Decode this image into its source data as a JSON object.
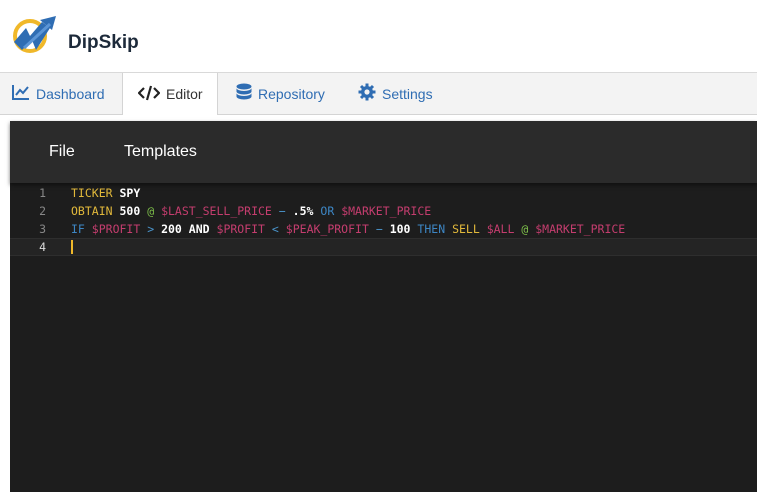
{
  "app": {
    "logo_text": "DipSkip"
  },
  "tabs": [
    {
      "label": "Dashboard",
      "icon": "chart-line-icon",
      "active": false
    },
    {
      "label": "Editor",
      "icon": "code-icon",
      "active": true
    },
    {
      "label": "Repository",
      "icon": "database-icon",
      "active": false
    },
    {
      "label": "Settings",
      "icon": "gear-icon",
      "active": false
    }
  ],
  "editor": {
    "menu": {
      "file": "File",
      "templates": "Templates"
    },
    "line_numbers": [
      "1",
      "2",
      "3",
      "4"
    ],
    "lines": [
      [
        {
          "t": "TICKER",
          "c": "kw"
        },
        {
          "t": " ",
          "c": "sym"
        },
        {
          "t": "SPY",
          "c": "white"
        }
      ],
      [
        {
          "t": "OBTAIN",
          "c": "kw"
        },
        {
          "t": " ",
          "c": "sym"
        },
        {
          "t": "500",
          "c": "num"
        },
        {
          "t": " ",
          "c": "sym"
        },
        {
          "t": "@",
          "c": "at"
        },
        {
          "t": " ",
          "c": "sym"
        },
        {
          "t": "$LAST_SELL_PRICE",
          "c": "var"
        },
        {
          "t": " ",
          "c": "sym"
        },
        {
          "t": "−",
          "c": "op"
        },
        {
          "t": " ",
          "c": "sym"
        },
        {
          "t": ".5%",
          "c": "pct"
        },
        {
          "t": " ",
          "c": "sym"
        },
        {
          "t": "OR",
          "c": "blue"
        },
        {
          "t": " ",
          "c": "sym"
        },
        {
          "t": "$MARKET_PRICE",
          "c": "var"
        }
      ],
      [
        {
          "t": "IF",
          "c": "blue"
        },
        {
          "t": " ",
          "c": "sym"
        },
        {
          "t": "$PROFIT",
          "c": "var"
        },
        {
          "t": " ",
          "c": "sym"
        },
        {
          "t": ">",
          "c": "op"
        },
        {
          "t": " ",
          "c": "sym"
        },
        {
          "t": "200",
          "c": "num"
        },
        {
          "t": " ",
          "c": "sym"
        },
        {
          "t": "AND",
          "c": "white"
        },
        {
          "t": " ",
          "c": "sym"
        },
        {
          "t": "$PROFIT",
          "c": "var"
        },
        {
          "t": " ",
          "c": "sym"
        },
        {
          "t": "<",
          "c": "op"
        },
        {
          "t": " ",
          "c": "sym"
        },
        {
          "t": "$PEAK_PROFIT",
          "c": "var"
        },
        {
          "t": " ",
          "c": "sym"
        },
        {
          "t": "−",
          "c": "op"
        },
        {
          "t": " ",
          "c": "sym"
        },
        {
          "t": "100",
          "c": "num"
        },
        {
          "t": " ",
          "c": "sym"
        },
        {
          "t": "THEN",
          "c": "blue"
        },
        {
          "t": " ",
          "c": "sym"
        },
        {
          "t": "SELL",
          "c": "kw"
        },
        {
          "t": " ",
          "c": "sym"
        },
        {
          "t": "$ALL",
          "c": "var"
        },
        {
          "t": " ",
          "c": "sym"
        },
        {
          "t": "@",
          "c": "at"
        },
        {
          "t": " ",
          "c": "sym"
        },
        {
          "t": "$MARKET_PRICE",
          "c": "var"
        }
      ],
      []
    ],
    "cursor_line": 4
  },
  "colors": {
    "brand_blue": "#2f6db3",
    "logo_gold": "#f0b82a",
    "editor_bg": "#1d1d1d",
    "menubar_bg": "#2b2b2b"
  }
}
